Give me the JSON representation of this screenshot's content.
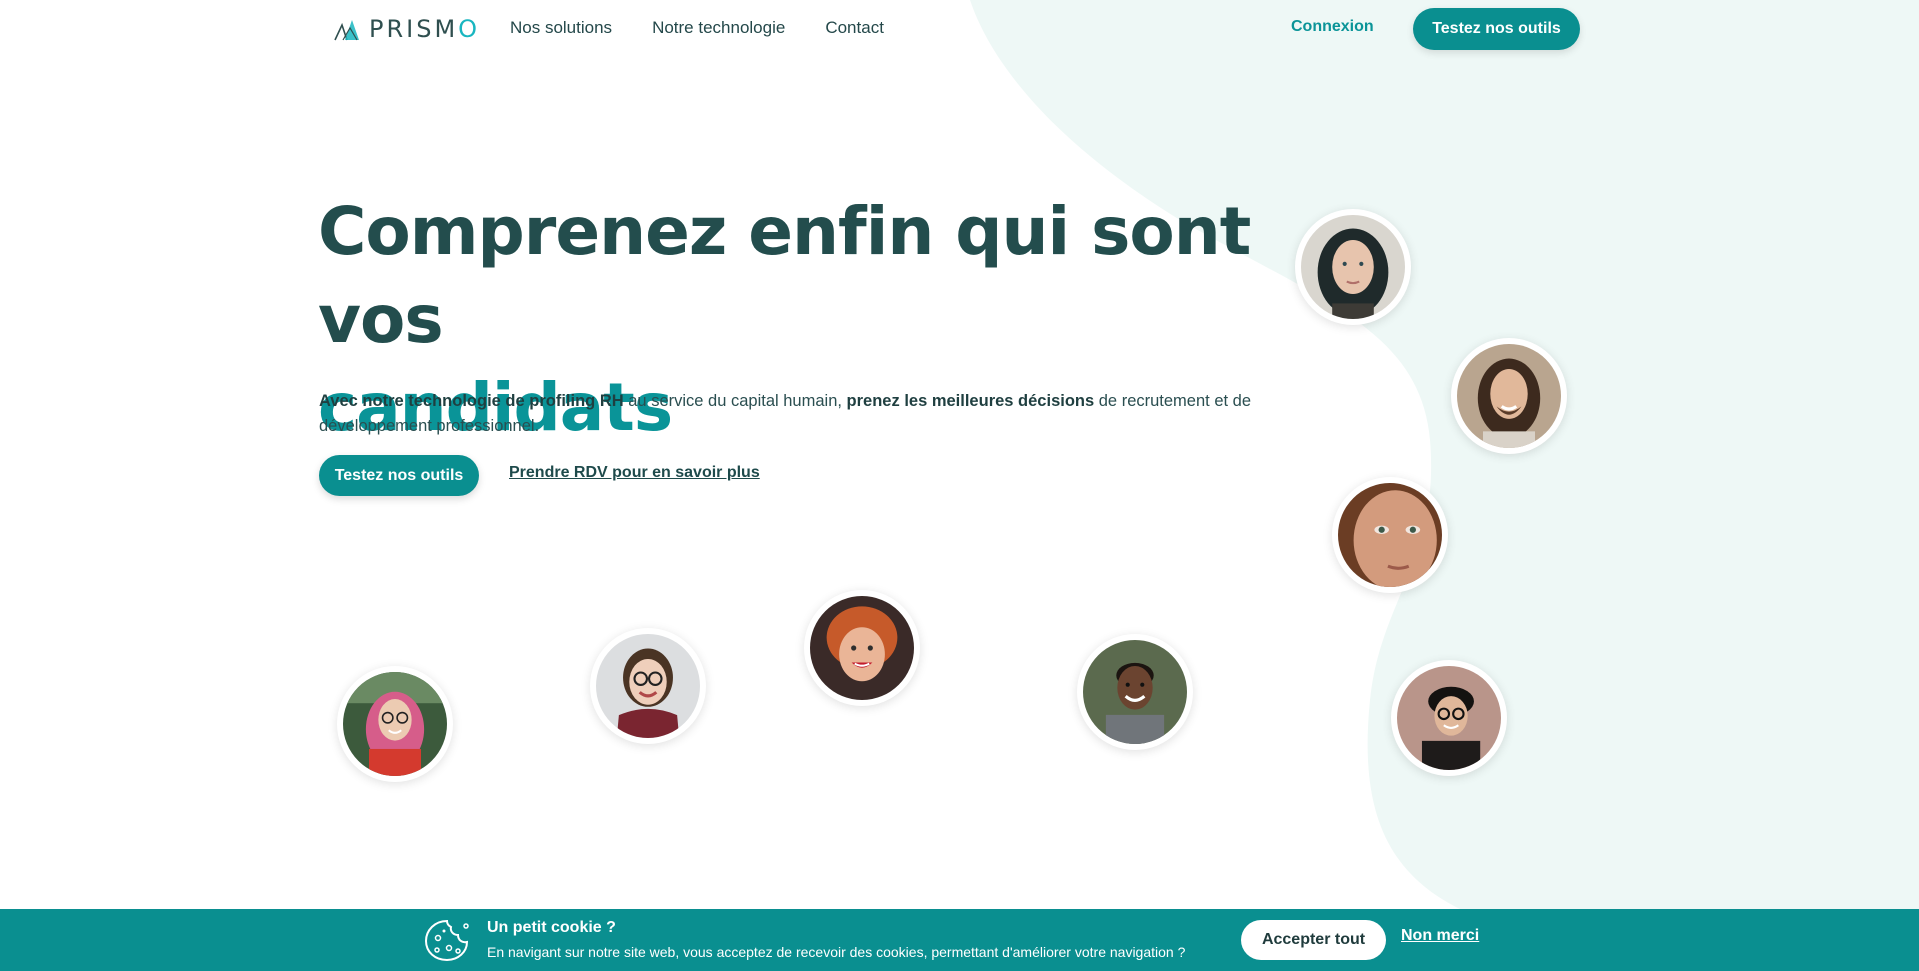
{
  "colors": {
    "accent": "#0a9498",
    "button": "#0a8f90",
    "dark_text": "#234d4d",
    "bg_shape": "#eef8f6"
  },
  "header": {
    "logo_text": "PRISMO",
    "nav": [
      {
        "label": "Nos solutions"
      },
      {
        "label": "Notre technologie"
      },
      {
        "label": "Contact"
      }
    ],
    "login_label": "Connexion",
    "cta_label": "Testez nos outils"
  },
  "hero": {
    "title_line1": "Comprenez enfin qui sont vos",
    "title_line2": "candidats",
    "desc_bold1": "Avec notre technologie de profiling RH",
    "desc_text1": " au service du capital humain, ",
    "desc_bold2": "prenez les meilleures décisions",
    "desc_text2": " de recrutement et de développement professionnel.",
    "cta_label": "Testez nos outils",
    "rdv_label": "Prendre RDV pour en savoir plus"
  },
  "avatars": [
    {
      "name": "woman-dark-hair"
    },
    {
      "name": "man-long-hair"
    },
    {
      "name": "woman-freckles"
    },
    {
      "name": "woman-pink-hair"
    },
    {
      "name": "woman-glasses-scarf"
    },
    {
      "name": "woman-red-hair"
    },
    {
      "name": "man-smiling"
    },
    {
      "name": "man-glasses"
    }
  ],
  "cookie": {
    "title": "Un petit cookie ?",
    "text": "En navigant sur notre site web, vous acceptez de recevoir des cookies, permettant d'améliorer votre navigation ?",
    "accept_label": "Accepter tout",
    "refuse_label": "Non merci",
    "icon": "cookie-icon"
  }
}
